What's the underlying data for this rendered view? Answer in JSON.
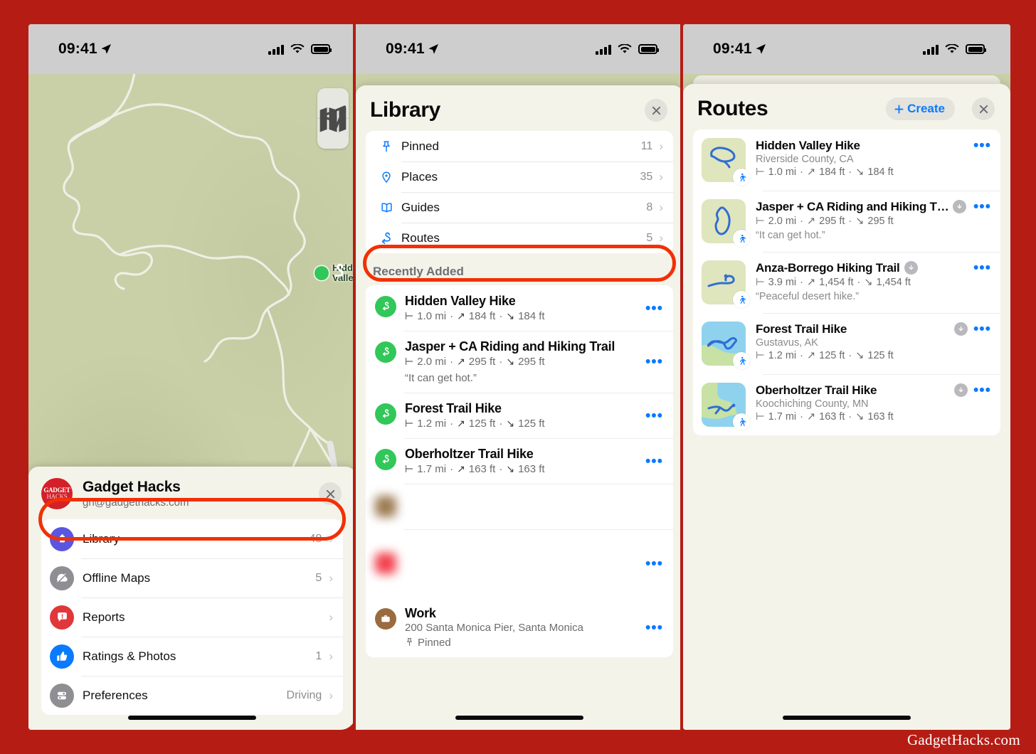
{
  "brand": {
    "ribbon": "GadgetHacks.com"
  },
  "status_bar": {
    "time": "09:41",
    "location_icon": "location-arrow-icon",
    "signal_icon": "cellular-bars-icon",
    "wifi_icon": "wifi-icon",
    "battery_icon": "battery-icon"
  },
  "colors": {
    "frame_red": "#b51d14",
    "highlight_ring": "#f23005",
    "accent_blue": "#0a7aff",
    "route_green": "#32c759",
    "library_purple": "#5b56e0",
    "map_green": "#c9cfa7",
    "sheet_bg": "#f4f3ea"
  },
  "panel1": {
    "map": {
      "label": "Hidden Valley",
      "pin_icon": "route-pin-icon"
    },
    "controls": [
      {
        "name": "map-layers-button",
        "icon": "map-stack-icon"
      },
      {
        "name": "locate-me-button",
        "icon": "location-arrow-icon"
      }
    ],
    "account": {
      "avatar_line1": "GADGET",
      "avatar_line2": "HACKS",
      "name": "Gadget Hacks",
      "email": "gh@gadgethacks.com",
      "close_icon": "close-icon"
    },
    "menu": [
      {
        "label": "Library",
        "value": "48",
        "icon": "library-icon",
        "icon_color": "#5b56e0",
        "highlighted": true
      },
      {
        "label": "Offline Maps",
        "value": "5",
        "icon": "offline-maps-icon",
        "icon_color": "#8e8e93",
        "highlighted": false
      },
      {
        "label": "Reports",
        "value": "",
        "icon": "reports-icon",
        "icon_color": "#e0373b",
        "highlighted": false
      },
      {
        "label": "Ratings & Photos",
        "value": "1",
        "icon": "thumbs-up-icon",
        "icon_color": "#0a7aff",
        "highlighted": false
      },
      {
        "label": "Preferences",
        "value": "Driving",
        "icon": "preferences-icon",
        "icon_color": "#8e8e93",
        "highlighted": false
      }
    ]
  },
  "panel2": {
    "title": "Library",
    "close_icon": "close-icon",
    "categories": [
      {
        "label": "Pinned",
        "count": "11",
        "icon": "pin-icon",
        "highlighted": false
      },
      {
        "label": "Places",
        "count": "35",
        "icon": "place-icon",
        "highlighted": false
      },
      {
        "label": "Guides",
        "count": "8",
        "icon": "book-icon",
        "highlighted": false
      },
      {
        "label": "Routes",
        "count": "5",
        "icon": "route-icon",
        "highlighted": true
      }
    ],
    "recently_added_label": "Recently Added",
    "recent_items": [
      {
        "title": "Hidden Valley Hike",
        "distance": "1.0 mi",
        "gain": "184 ft",
        "loss": "184 ft",
        "note": ""
      },
      {
        "title": "Jasper + CA Riding and Hiking Trail",
        "distance": "2.0 mi",
        "gain": "295 ft",
        "loss": "295 ft",
        "note": "“It can get hot.”"
      },
      {
        "title": "Forest Trail Hike",
        "distance": "1.2 mi",
        "gain": "125 ft",
        "loss": "125 ft",
        "note": ""
      },
      {
        "title": "Oberholtzer Trail Hike",
        "distance": "1.7 mi",
        "gain": "163 ft",
        "loss": "163 ft",
        "note": ""
      }
    ],
    "work_item": {
      "title": "Work",
      "address": "200 Santa Monica Pier, Santa Monica",
      "tag": "Pinned",
      "icon": "briefcase-icon"
    }
  },
  "panel3": {
    "title": "Routes",
    "create_label": "Create",
    "create_icon": "plus-icon",
    "close_icon": "close-icon",
    "routes": [
      {
        "title": "Hidden Valley Hike",
        "sub": "Riverside County, CA",
        "distance": "1.0 mi",
        "gain": "184 ft",
        "loss": "184 ft",
        "note": "",
        "downloadable": false,
        "thumb": "thumb-hidden-valley"
      },
      {
        "title": "Jasper + CA Riding and Hiking T…",
        "sub": "",
        "distance": "2.0 mi",
        "gain": "295 ft",
        "loss": "295 ft",
        "note": "“It can get hot.”",
        "downloadable": true,
        "thumb": "thumb-jasper"
      },
      {
        "title": "Anza-Borrego Hiking Trail",
        "sub": "",
        "distance": "3.9 mi",
        "gain": "1,454 ft",
        "loss": "1,454 ft",
        "note": "“Peaceful desert hike.”",
        "downloadable": true,
        "thumb": "thumb-anza"
      },
      {
        "title": "Forest Trail Hike",
        "sub": "Gustavus, AK",
        "distance": "1.2 mi",
        "gain": "125 ft",
        "loss": "125 ft",
        "note": "",
        "downloadable": true,
        "thumb": "thumb-forest"
      },
      {
        "title": "Oberholtzer Trail Hike",
        "sub": "Koochiching County, MN",
        "distance": "1.7 mi",
        "gain": "163 ft",
        "loss": "163 ft",
        "note": "",
        "downloadable": true,
        "thumb": "thumb-oberholtzer"
      }
    ]
  }
}
